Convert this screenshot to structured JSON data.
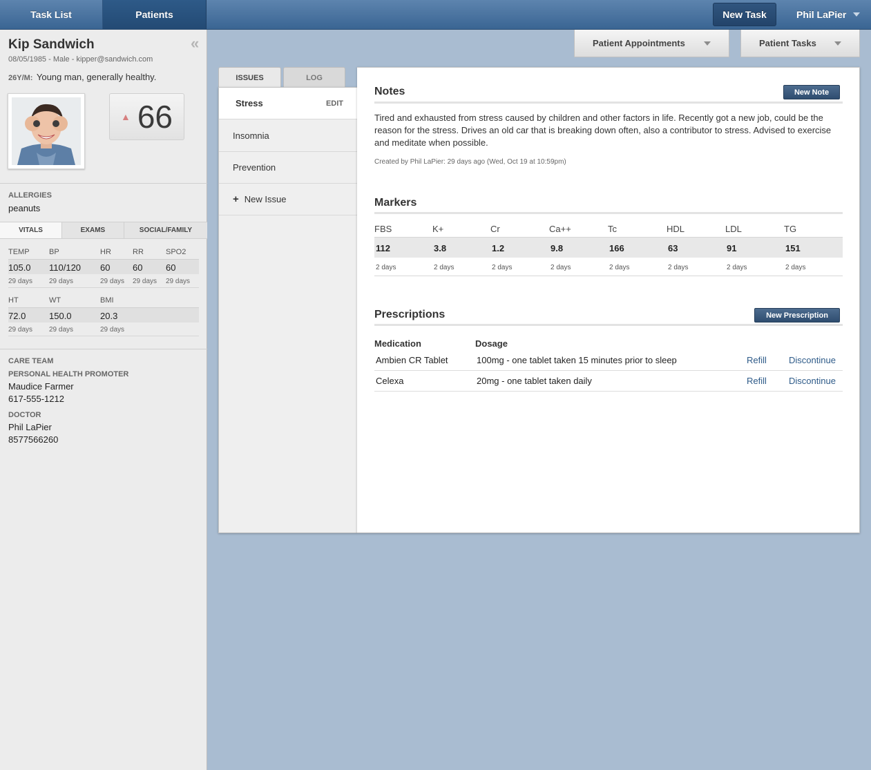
{
  "nav": {
    "tabs": [
      "Task List",
      "Patients"
    ],
    "new_task": "New Task",
    "user": "Phil LaPier"
  },
  "subheader": {
    "appointments": "Patient Appointments",
    "tasks": "Patient Tasks"
  },
  "patient": {
    "name": "Kip Sandwich",
    "meta": "08/05/1985 - Male - kipper@sandwich.com",
    "age_tag": "26Y/M:",
    "summary": "Young man, generally healthy.",
    "score": "66",
    "allergies_label": "ALLERGIES",
    "allergies": "peanuts"
  },
  "vitals_tabs": [
    "VITALS",
    "EXAMS",
    "SOCIAL/FAMILY"
  ],
  "vitals": {
    "row1": {
      "headers": [
        "TEMP",
        "BP",
        "HR",
        "RR",
        "SPO2"
      ],
      "values": [
        "105.0",
        "110/120",
        "60",
        "60",
        "60"
      ],
      "dates": [
        "29 days",
        "29 days",
        "29 days",
        "29 days",
        "29 days"
      ]
    },
    "row2": {
      "headers": [
        "HT",
        "WT",
        "BMI"
      ],
      "values": [
        "72.0",
        "150.0",
        "20.3"
      ],
      "dates": [
        "29 days",
        "29 days",
        "29 days"
      ]
    }
  },
  "care_team": {
    "label": "CARE TEAM",
    "promoter_label": "PERSONAL HEALTH PROMOTER",
    "promoter_name": "Maudice Farmer",
    "promoter_phone": "617-555-1212",
    "doctor_label": "DOCTOR",
    "doctor_name": "Phil LaPier",
    "doctor_phone": "8577566260"
  },
  "panel_tabs": [
    "ISSUES",
    "LOG"
  ],
  "issues": {
    "items": [
      "Stress",
      "Insomnia",
      "Prevention"
    ],
    "edit": "EDIT",
    "new_issue": "New Issue"
  },
  "notes": {
    "title": "Notes",
    "new_button": "New Note",
    "text": "Tired and exhausted from stress caused by children and other factors in life. Recently got a new job, could be the reason for the stress. Drives an old car that is breaking down often, also a contributor to stress. Advised to exercise and meditate when possible.",
    "meta": "Created by Phil LaPier: 29 days ago (Wed, Oct 19 at 10:59pm)"
  },
  "markers": {
    "title": "Markers",
    "headers": [
      "FBS",
      "K+",
      "Cr",
      "Ca++",
      "Tc",
      "HDL",
      "LDL",
      "TG"
    ],
    "values": [
      "112",
      "3.8",
      "1.2",
      "9.8",
      "166",
      "63",
      "91",
      "151"
    ],
    "dates": [
      "2 days",
      "2 days",
      "2 days",
      "2 days",
      "2 days",
      "2 days",
      "2 days",
      "2 days"
    ]
  },
  "prescriptions": {
    "title": "Prescriptions",
    "new_button": "New Prescription",
    "col_medication": "Medication",
    "col_dosage": "Dosage",
    "rows": [
      {
        "medication": "Ambien CR Tablet",
        "dosage": "100mg - one tablet taken 15 minutes prior to sleep",
        "refill": "Refill",
        "discontinue": "Discontinue"
      },
      {
        "medication": "Celexa",
        "dosage": "20mg - one tablet taken daily",
        "refill": "Refill",
        "discontinue": "Discontinue"
      }
    ]
  }
}
